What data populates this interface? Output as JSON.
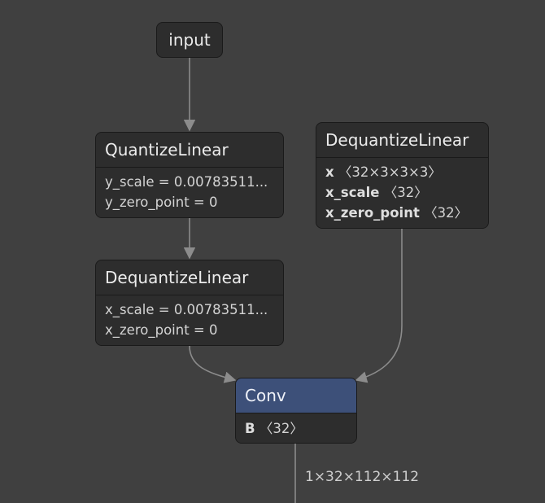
{
  "nodes": {
    "input": {
      "title": "input"
    },
    "quantize": {
      "title": "QuantizeLinear",
      "attrs": [
        "y_scale = 0.00783511...",
        "y_zero_point = 0"
      ]
    },
    "dequantize_input": {
      "title": "DequantizeLinear",
      "attrs": [
        "x_scale = 0.00783511...",
        "x_zero_point = 0"
      ]
    },
    "dequantize_weight": {
      "title": "DequantizeLinear",
      "inputs": [
        {
          "name": "x",
          "shape": "〈32×3×3×3〉"
        },
        {
          "name": "x_scale",
          "shape": "〈32〉"
        },
        {
          "name": "x_zero_point",
          "shape": "〈32〉"
        }
      ]
    },
    "conv": {
      "title": "Conv",
      "inputs": [
        {
          "name": "B",
          "shape": "〈32〉"
        }
      ]
    }
  },
  "edges": {
    "conv_output_label": "1×32×112×112"
  },
  "colors": {
    "background": "#404040",
    "node_fill": "#2d2d2d",
    "node_border": "#1a1a1a",
    "conv_header": "#3d5079",
    "edge": "#8c8c8c"
  }
}
